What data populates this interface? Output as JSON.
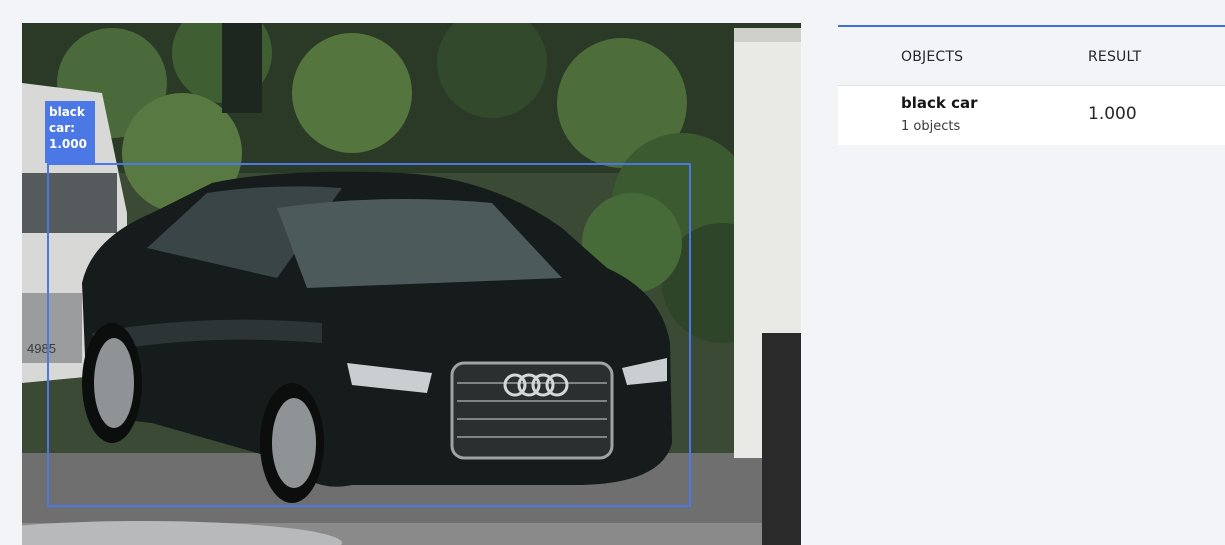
{
  "detection": {
    "label_line1": "black",
    "label_line2": "car:",
    "label_line3": "1.000",
    "box_color": "#4c78e6"
  },
  "results": {
    "header_objects": "OBJECTS",
    "header_result": "RESULT",
    "rows": [
      {
        "name": "black car",
        "count": "1 objects",
        "score": "1.000"
      }
    ]
  },
  "photo": {
    "plate_text": "4985"
  },
  "colors": {
    "accent": "#3d6fdc",
    "background": "#f2f4f8"
  }
}
